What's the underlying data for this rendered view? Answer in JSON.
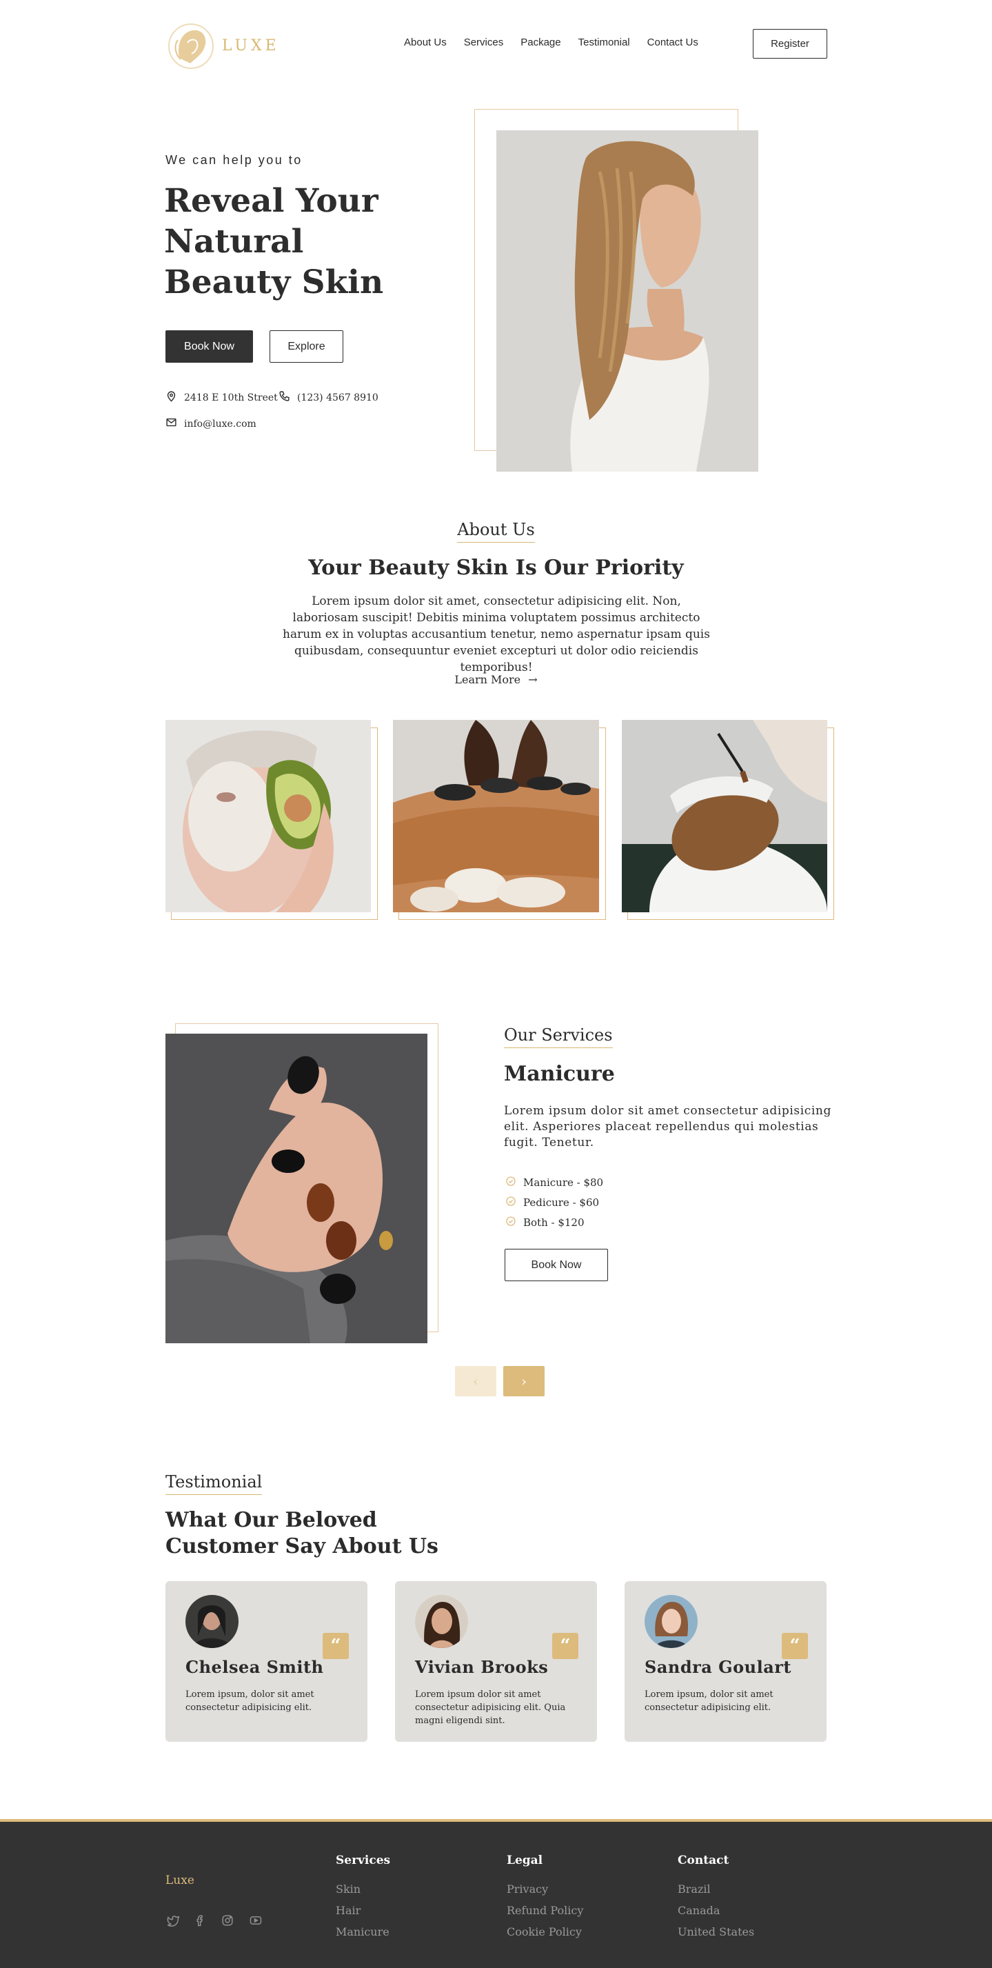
{
  "brand": {
    "name": "LUXE",
    "footer_name": "Luxe"
  },
  "colors": {
    "accent": "#dcbb7c",
    "dark": "#333333",
    "frame": "#e6c9a4",
    "card": "#e0dfdc"
  },
  "nav": {
    "items": [
      "About Us",
      "Services",
      "Package",
      "Testimonial",
      "Contact Us"
    ],
    "register": "Register"
  },
  "hero": {
    "eyebrow": "We can help you to",
    "title": "Reveal Your Natural Beauty Skin",
    "primary_btn": "Book Now",
    "secondary_btn": "Explore",
    "address": "2418 E 10th Street",
    "phone": "(123) 4567 8910",
    "email": "info@luxe.com",
    "icons": [
      "map-pin-icon",
      "phone-icon",
      "mail-icon"
    ]
  },
  "about": {
    "eyebrow": "About Us",
    "title": "Your Beauty Skin Is Our Priority",
    "body": "Lorem ipsum dolor sit amet, consectetur adipisicing elit. Non, laboriosam suscipit! Debitis minima voluptatem possimus architecto harum ex in voluptas accusantium tenetur, nemo aspernatur ipsam quis quibusdam, consequuntur eveniet excepturi ut dolor odio reiciendis temporibus!",
    "link": "Learn More"
  },
  "services": {
    "eyebrow": "Our Services",
    "title": "Manicure",
    "body": "Lorem ipsum dolor sit amet consectetur adipisicing elit. Asperiores placeat repellendus qui molestias fugit. Tenetur.",
    "items": [
      "Manicure - $80",
      "Pedicure - $60",
      "Both - $120"
    ],
    "book": "Book Now"
  },
  "testimonial": {
    "eyebrow": "Testimonial",
    "title": "What Our Beloved Customer Say About Us",
    "cards": [
      {
        "name": "Chelsea Smith",
        "text": "Lorem ipsum, dolor sit amet consectetur adipisicing elit."
      },
      {
        "name": "Vivian Brooks",
        "text": "Lorem ipsum dolor sit amet consectetur adipisicing elit. Quia magni eligendi sint."
      },
      {
        "name": "Sandra Goulart",
        "text": "Lorem ipsum, dolor sit amet consectetur adipisicing elit."
      }
    ]
  },
  "footer": {
    "social": [
      "twitter-icon",
      "facebook-icon",
      "instagram-icon",
      "youtube-icon"
    ],
    "columns": [
      {
        "heading": "Services",
        "links": [
          "Skin",
          "Hair",
          "Manicure"
        ]
      },
      {
        "heading": "Legal",
        "links": [
          "Privacy",
          "Refund Policy",
          "Cookie Policy"
        ]
      },
      {
        "heading": "Contact",
        "links": [
          "Brazil",
          "Canada",
          "United States"
        ]
      }
    ]
  }
}
